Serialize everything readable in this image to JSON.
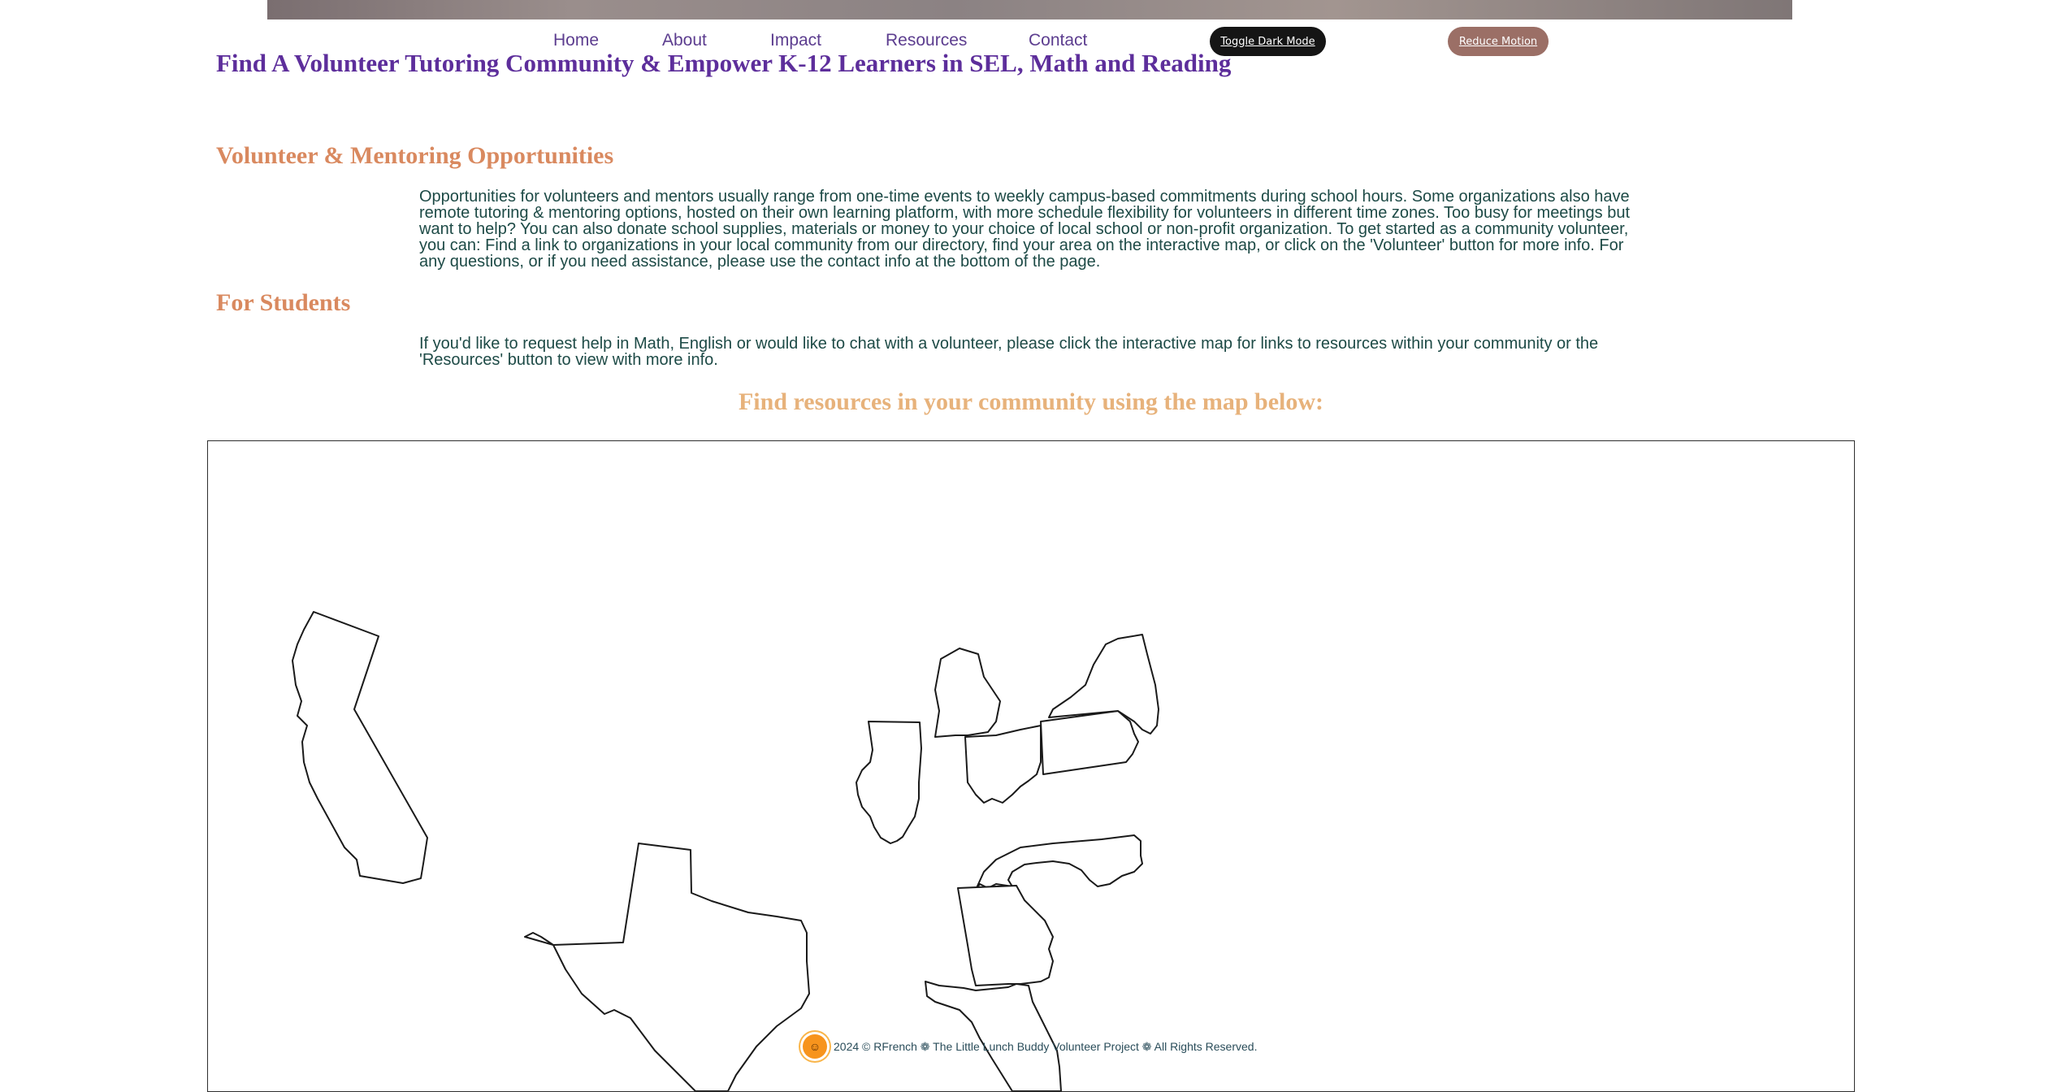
{
  "nav": {
    "home": "Home",
    "about": "About",
    "impact": "Impact",
    "resources": "Resources",
    "contact": "Contact",
    "toggle_dark": "Toggle Dark Mode",
    "reduce_motion": "Reduce Motion"
  },
  "page": {
    "title": "Find A Volunteer Tutoring Community & Empower K-12 Learners in SEL, Math and Reading"
  },
  "volunteer": {
    "heading": "Volunteer & Mentoring Opportunities",
    "body": "Opportunities for volunteers and mentors usually range from one-time events to weekly campus-based commitments during school hours. Some organizations also have remote tutoring & mentoring options, hosted on their own learning platform, with more schedule flexibility for volunteers in different time zones. Too busy for meetings but want to help? You can also donate school supplies, materials or money to your choice of local school or non-profit organization. To get started as a community volunteer, you can: Find a link to organizations in your local community from our directory, find your area on the interactive map, or click on the 'Volunteer' button for more info. For any questions, or if you need assistance, please use the contact info at the bottom of the page."
  },
  "students": {
    "heading": "For Students",
    "body": "If you'd like to request help in Math, English or would like to chat with a volunteer, please click the interactive map for links to resources within your community or the 'Resources' button to view with more info."
  },
  "map": {
    "heading": "Find resources in your community using the map below:",
    "states": [
      "California",
      "Texas",
      "Illinois",
      "Michigan",
      "Ohio",
      "Pennsylvania",
      "New York",
      "North Carolina",
      "Georgia",
      "Florida"
    ]
  },
  "footer": {
    "text": "2024 © RFrench ❁ The Little Lunch Buddy Volunteer Project ❁ All Rights Reserved."
  },
  "colors": {
    "title": "#5d2e9b",
    "heading": "#d9895f",
    "map_heading": "#e7b27b",
    "body": "#1d4a46",
    "dark_button": "#151515",
    "motion_button": "#9b6f66"
  }
}
